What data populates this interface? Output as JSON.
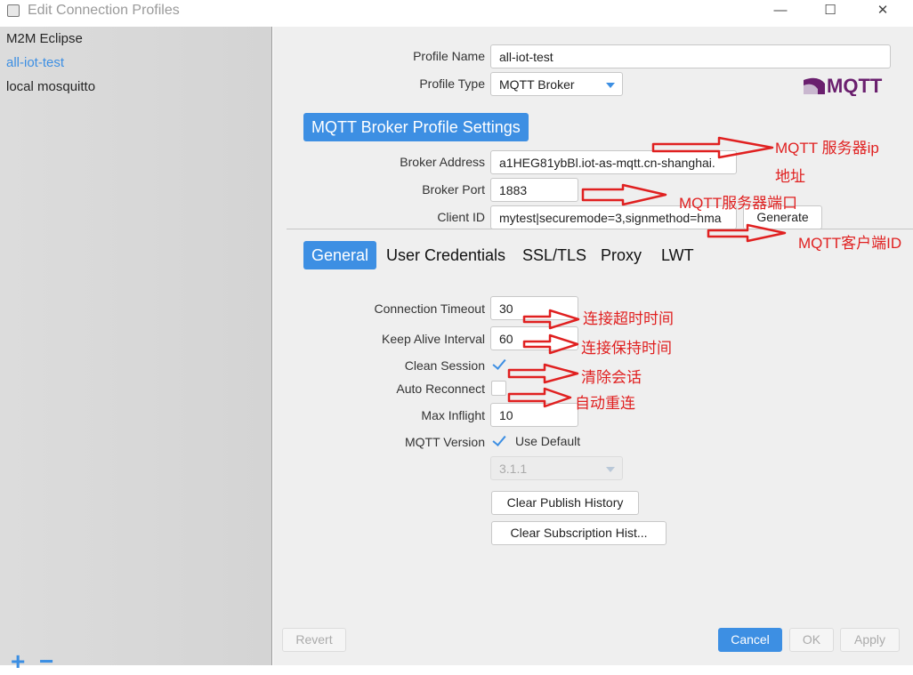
{
  "window": {
    "title": "Edit Connection Profiles"
  },
  "controls": {
    "minimize": "—",
    "maximize": "☐",
    "close": "✕"
  },
  "sidebar": {
    "items": [
      {
        "label": "M2M Eclipse"
      },
      {
        "label": "all-iot-test"
      },
      {
        "label": "local mosquitto"
      }
    ],
    "add": "+",
    "remove": "−"
  },
  "profile": {
    "name_label": "Profile Name",
    "name_value": "all-iot-test",
    "type_label": "Profile Type",
    "type_value": "MQTT Broker",
    "logo_text": "MQTT"
  },
  "section_title": "MQTT Broker Profile Settings",
  "broker": {
    "address_label": "Broker Address",
    "address_value": "a1HEG81ybBl.iot-as-mqtt.cn-shanghai.",
    "port_label": "Broker Port",
    "port_value": "1883",
    "client_label": "Client ID",
    "client_value": "mytest|securemode=3,signmethod=hma",
    "generate": "Generate"
  },
  "tabs": [
    {
      "label": "General"
    },
    {
      "label": "User Credentials"
    },
    {
      "label": "SSL/TLS"
    },
    {
      "label": "Proxy"
    },
    {
      "label": "LWT"
    }
  ],
  "general": {
    "timeout_label": "Connection Timeout",
    "timeout_value": "30",
    "keepalive_label": "Keep Alive Interval",
    "keepalive_value": "60",
    "clean_label": "Clean Session",
    "clean_checked": true,
    "auto_label": "Auto Reconnect",
    "auto_checked": false,
    "inflight_label": "Max Inflight",
    "inflight_value": "10",
    "version_label": "MQTT Version",
    "use_default": "Use Default",
    "use_default_checked": true,
    "version_value": "3.1.1",
    "clear_publish": "Clear Publish History",
    "clear_subscription": "Clear Subscription Hist..."
  },
  "footer": {
    "revert": "Revert",
    "cancel": "Cancel",
    "ok": "OK",
    "apply": "Apply"
  },
  "annotations": {
    "server_ip_line1": "MQTT 服务器ip",
    "server_ip_line2": "地址",
    "server_port": "MQTT服务器端口",
    "client_id": "MQTT客户端ID",
    "timeout": "连接超时时间",
    "keepalive": "连接保持时间",
    "clean": "清除会话",
    "auto": "自动重连"
  },
  "colors": {
    "accent": "#3d8fe3",
    "annotation": "#e02020"
  }
}
